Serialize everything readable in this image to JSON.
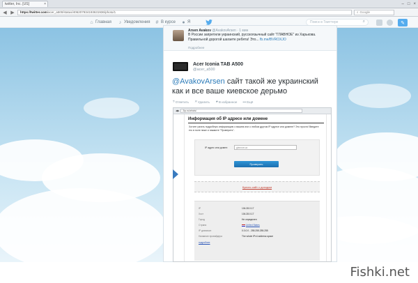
{
  "browser": {
    "tab_title": "twitter, Inc. [US]",
    "tab_close": "×",
    "window_buttons": [
      "–",
      "□",
      "×"
    ],
    "url_host": "https://twitter.com",
    "url_path": "/acer_a500/status/406207934193631936/photo/1",
    "search_placeholder": "Google",
    "search_icon": "magnifier-icon"
  },
  "topbar": {
    "home_label": "Главная",
    "notifications_label": "Уведомления",
    "discover_label": "В курсе",
    "me_label": "Я",
    "search_placeholder": "Поиск в Твиттере",
    "compose_glyph": "✎"
  },
  "reply_tweet": {
    "name": "Arsen Avakov",
    "handle": "@AvakovArsen · 1 мин",
    "text": "В России запретили украинский, русскоязычный сайт \"ГЛАВНОЕ\" из Харькова. Правильной дорогой шагаете ребята! Это...",
    "link": "fb.me/BVROXJO",
    "more": "Подробнее"
  },
  "main_tweet": {
    "name": "Acer Iconia TAB A500",
    "handle": "@acer_a500",
    "mention": "@AvakovArsen",
    "text": " сайт такой же украинский как и все ваше киевское дерьмо",
    "actions": [
      "Ответить",
      "Удалить",
      "В избранное",
      "Ещё"
    ]
  },
  "embedded": {
    "url": "2ip.ru/whois/",
    "title": "Информация об IP адресе или домене",
    "description": "Хотите узнать подробную информацию о вашем или о любом другом IP адресе или домене? Это просто! Введите его в поле ниже и нажмите \"Проверить\".",
    "field_label": "IP адрес или домен:",
    "field_value": "glavnoe.ua",
    "button_label": "Проверить",
    "site_link": "Купить сайт с доходом",
    "rows": [
      {
        "k": "IP",
        "v": "104.28.0.17"
      },
      {
        "k": "Хост",
        "v": "104.28.0.17"
      },
      {
        "k": "Город",
        "v": "Не определен"
      },
      {
        "k": "Страна",
        "v": "United States"
      },
      {
        "k": "IP диапазон",
        "v": "0.0.0.0 - 255.255.255.255"
      },
      {
        "k": "Название провайдера",
        "v": "The whole IPv4 address space"
      }
    ],
    "details_link": "подробнее"
  },
  "watermark": "Fishki.net"
}
